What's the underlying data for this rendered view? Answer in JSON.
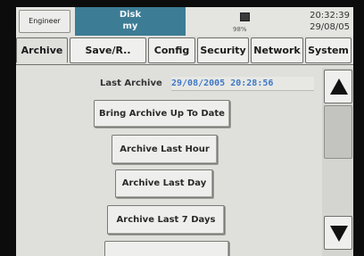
{
  "status": {
    "user": "Engineer",
    "disk_title": "Disk",
    "disk_name": "my",
    "disk_usage": "98%",
    "time": "20:32:39",
    "date": "29/08/05"
  },
  "tabs": [
    {
      "label": "Archive",
      "active": true
    },
    {
      "label": "Save/R..",
      "active": false
    },
    {
      "label": "Config",
      "active": false
    },
    {
      "label": "Security",
      "active": false
    },
    {
      "label": "Network",
      "active": false
    },
    {
      "label": "System",
      "active": false
    }
  ],
  "archive": {
    "last_label": "Last Archive",
    "last_value": "29/08/2005 20:28:56",
    "buttons": [
      "Bring Archive Up To Date",
      "Archive Last Hour",
      "Archive Last Day",
      "Archive Last 7 Days",
      ""
    ]
  },
  "icons": {
    "scroll_up": "triangle-up-icon",
    "scroll_down": "triangle-down-icon",
    "disk": "disk-icon"
  },
  "colors": {
    "disk_panel": "#3d7c95",
    "timestamp_text": "#3f78c8",
    "screen_bg": "#dfe0dc"
  }
}
